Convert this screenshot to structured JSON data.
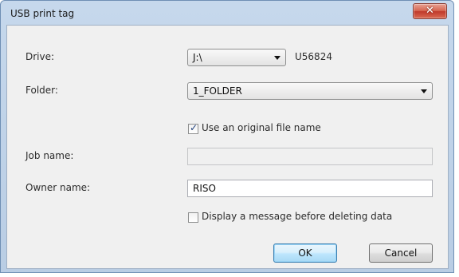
{
  "window": {
    "title": "USB print tag",
    "close_icon": "close-icon"
  },
  "form": {
    "drive": {
      "label": "Drive:",
      "value": "J:\\",
      "volume_label": "U56824"
    },
    "folder": {
      "label": "Folder:",
      "value": "1_FOLDER"
    },
    "use_original_file_name": {
      "label": "Use an original file name",
      "checked": true
    },
    "job_name": {
      "label": "Job name:",
      "value": "",
      "enabled": false
    },
    "owner_name": {
      "label": "Owner name:",
      "value": "RISO"
    },
    "display_message": {
      "label": "Display a message before deleting data",
      "checked": false
    }
  },
  "buttons": {
    "ok": "OK",
    "cancel": "Cancel"
  },
  "colors": {
    "frame": "#b9cde4",
    "client": "#f0f0f0",
    "close_button": "#c0392a",
    "default_button": "#a7d9f5"
  }
}
